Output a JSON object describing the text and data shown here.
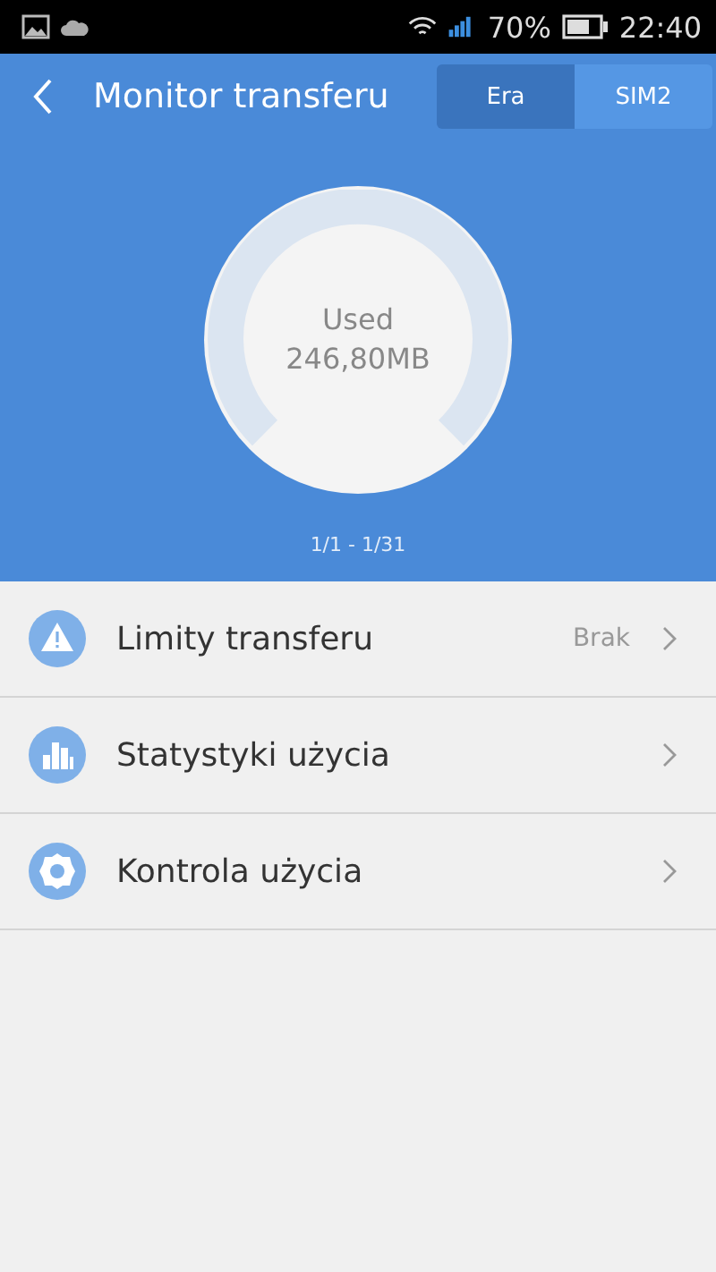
{
  "status_bar": {
    "battery": "70%",
    "time": "22:40"
  },
  "header": {
    "title": "Monitor transferu",
    "sims": [
      {
        "label": "Era",
        "selected": true
      },
      {
        "label": "SIM2",
        "selected": false
      }
    ]
  },
  "gauge": {
    "label": "Used",
    "value": "246,80MB",
    "period": "1/1 - 1/31"
  },
  "items": [
    {
      "kind": "warning",
      "label": "Limity transferu",
      "value": "Brak"
    },
    {
      "kind": "stats",
      "label": "Statystyki użycia"
    },
    {
      "kind": "settings",
      "label": "Kontrola użycia"
    }
  ]
}
